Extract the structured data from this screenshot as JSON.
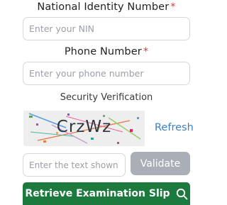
{
  "nin": {
    "label": "National Identity Number",
    "required_mark": "*",
    "placeholder": "Enter your NIN",
    "value": ""
  },
  "phone": {
    "label": "Phone Number",
    "required_mark": "*",
    "placeholder": "Enter your phone number",
    "value": ""
  },
  "security": {
    "label": "Security Verification",
    "captcha_text": "CrzWz",
    "refresh_label": "Refresh",
    "input_placeholder": "Enter the text shown c",
    "validate_label": "Validate"
  },
  "actions": {
    "retrieve_label": "Retrieve Examination Slip",
    "retrieve_icon": "search-icon"
  },
  "colors": {
    "required": "#e53935",
    "link": "#3b7fcc",
    "primary_button": "#1c7a3e",
    "disabled_button": "#a9aeb7"
  }
}
